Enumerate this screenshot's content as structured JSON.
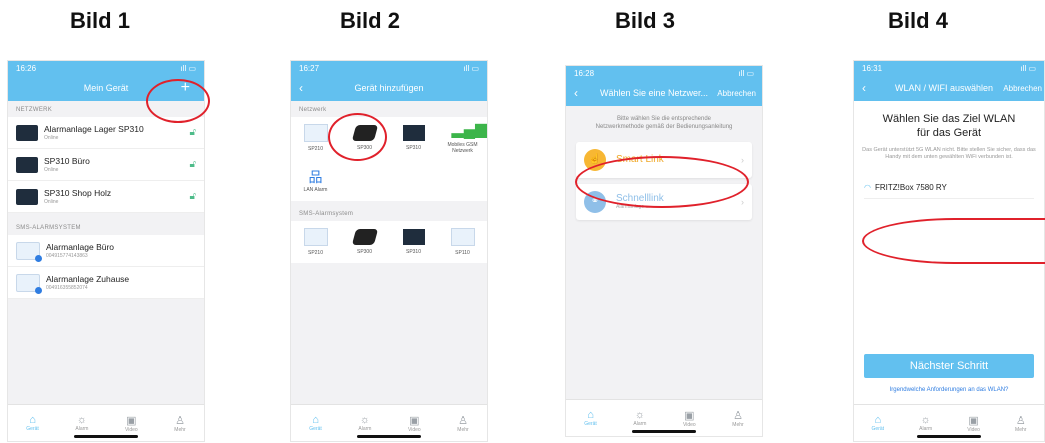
{
  "captions": [
    "Bild 1",
    "Bild 2",
    "Bild 3",
    "Bild 4"
  ],
  "bild1": {
    "time": "16:26",
    "title": "Mein Gerät",
    "plus": "+",
    "section_network": "NETZWERK",
    "devices_network": [
      {
        "name": "Alarmanlage Lager SP310",
        "status": "Online"
      },
      {
        "name": "SP310 Büro",
        "status": "Online"
      },
      {
        "name": "SP310 Shop Holz",
        "status": "Online"
      }
    ],
    "section_sms": "SMS-ALARMSYSTEM",
    "devices_sms": [
      {
        "name": "Alarmanlage Büro",
        "status": "004915774143863"
      },
      {
        "name": "Alarmanlage Zuhause",
        "status": "004916355852074"
      }
    ]
  },
  "bild2": {
    "time": "16:27",
    "title": "Gerät hinzufügen",
    "section_network": "Netzwerk",
    "network_items": [
      "SP210",
      "SP300",
      "SP310",
      "Mobiles GSM Netzwerk",
      "LAN Alarm"
    ],
    "section_sms": "SMS-Alarmsystem",
    "sms_items": [
      "SP210",
      "SP300",
      "SP310",
      "SP110"
    ]
  },
  "bild3": {
    "time": "16:28",
    "title": "Wählen Sie eine Netzwer...",
    "cancel": "Abbrechen",
    "instruction": "Bitte wählen Sie die entsprechende Netzwerkmethode gemäß der Bedienungsanleitung",
    "smart_link": "Smart Link",
    "schnelllink": "Schnelllink",
    "schnelllink_sub": "Alarmanlage ..."
  },
  "bild4": {
    "time": "16:31",
    "title": "WLAN / WIFI auswählen",
    "cancel": "Abbrechen",
    "heading": "Wählen Sie das Ziel WLAN für das Gerät",
    "description": "Das Gerät unterstützt 5G WLAN nicht. Bitte stellen Sie sicher, dass das Handy mit dem unten gewählten WiFi verbunden ist.",
    "wifi_name": "FRITZ!Box 7580 RY",
    "next_button": "Nächster Schritt",
    "help_link": "Irgendwelche Anforderungen an das WLAN?"
  },
  "tabs": [
    "Gerät",
    "Alarm",
    "Video",
    "Mehr"
  ],
  "colors": {
    "accent": "#62c0ef",
    "highlight": "#e0212b",
    "smart_link": "#f7b733",
    "schnelllink": "#8fbfe8"
  }
}
